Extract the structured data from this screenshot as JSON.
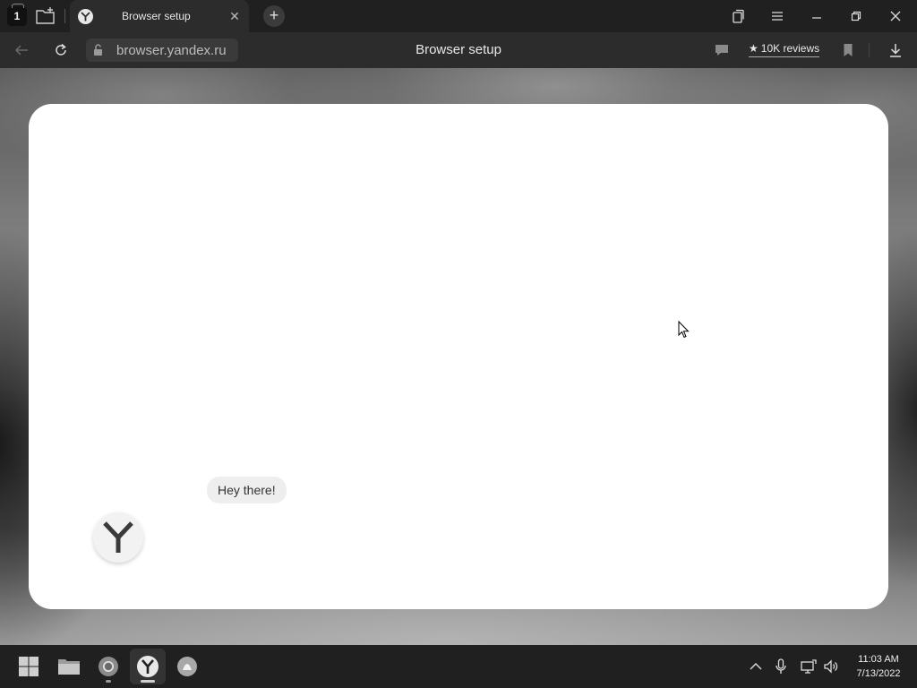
{
  "tabstrip": {
    "tab_count": "1",
    "active_tab": {
      "title": "Browser setup",
      "close_glyph": "✕"
    },
    "new_tab_glyph": "+"
  },
  "toolbar": {
    "url": "browser.yandex.ru",
    "page_title": "Browser setup",
    "reviews": {
      "star": "★",
      "label": "10K reviews"
    }
  },
  "card": {
    "greeting": "Hey there!"
  },
  "taskbar": {
    "apps": [
      {
        "name": "start",
        "icon": "windows-logo-icon"
      },
      {
        "name": "file-explorer",
        "icon": "folder-icon"
      },
      {
        "name": "chrome",
        "icon": "chrome-icon"
      },
      {
        "name": "yandex-browser",
        "icon": "yandex-browser-icon"
      },
      {
        "name": "alice",
        "icon": "alice-icon"
      }
    ],
    "clock": {
      "time": "11:03 AM",
      "date": "7/13/2022"
    }
  }
}
